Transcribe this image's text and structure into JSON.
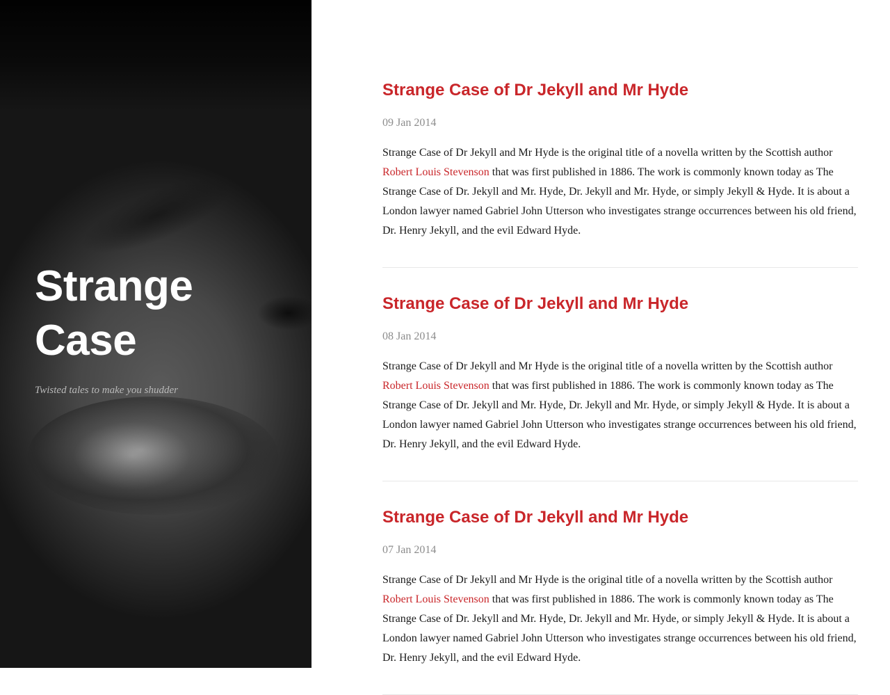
{
  "site": {
    "title_line1": "Strange",
    "title_line2": "Case",
    "tagline": "Twisted tales to make you shudder"
  },
  "posts": [
    {
      "title": "Strange Case of Dr Jekyll and Mr Hyde",
      "date": "09 Jan 2014",
      "body_before": "Strange Case of Dr Jekyll and Mr Hyde is the original title of a novella written by the Scottish author ",
      "link_text": "Robert Louis Stevenson",
      "body_after": " that was first published in 1886. The work is commonly known today as The Strange Case of Dr. Jekyll and Mr. Hyde, Dr. Jekyll and Mr. Hyde, or simply Jekyll & Hyde. It is about a London lawyer named Gabriel John Utterson who investigates strange occurrences between his old friend, Dr. Henry Jekyll, and the evil Edward Hyde."
    },
    {
      "title": "Strange Case of Dr Jekyll and Mr Hyde",
      "date": "08 Jan 2014",
      "body_before": "Strange Case of Dr Jekyll and Mr Hyde is the original title of a novella written by the Scottish author ",
      "link_text": "Robert Louis Stevenson",
      "body_after": " that was first published in 1886. The work is commonly known today as The Strange Case of Dr. Jekyll and Mr. Hyde, Dr. Jekyll and Mr. Hyde, or simply Jekyll & Hyde. It is about a London lawyer named Gabriel John Utterson who investigates strange occurrences between his old friend, Dr. Henry Jekyll, and the evil Edward Hyde."
    },
    {
      "title": "Strange Case of Dr Jekyll and Mr Hyde",
      "date": "07 Jan 2014",
      "body_before": "Strange Case of Dr Jekyll and Mr Hyde is the original title of a novella written by the Scottish author ",
      "link_text": "Robert Louis Stevenson",
      "body_after": " that was first published in 1886. The work is commonly known today as The Strange Case of Dr. Jekyll and Mr. Hyde, Dr. Jekyll and Mr. Hyde, or simply Jekyll & Hyde. It is about a London lawyer named Gabriel John Utterson who investigates strange occurrences between his old friend, Dr. Henry Jekyll, and the evil Edward Hyde."
    }
  ],
  "colors": {
    "accent": "#c9262a",
    "date": "#8c8c8c",
    "text": "#1a1a1a",
    "divider": "#e8e8e8"
  }
}
